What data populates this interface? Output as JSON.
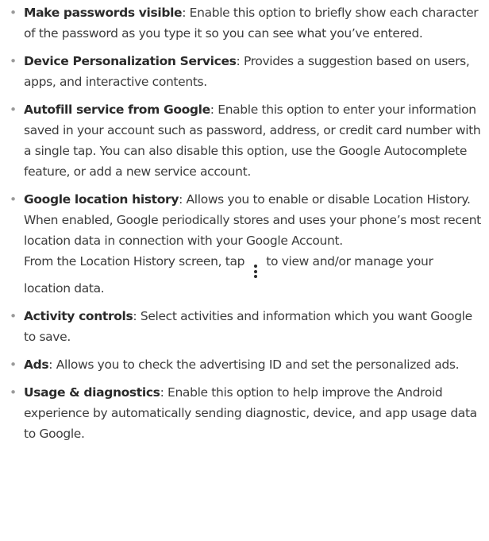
{
  "bullet_char": "•",
  "items": [
    {
      "term": "Make passwords visible",
      "desc": ": Enable this option to briefly show each character of the password as you type it so you can see what you’ve entered."
    },
    {
      "term": "Device Personalization Services",
      "desc": ": Provides a suggestion based on users, apps, and interactive contents."
    },
    {
      "term": "Autofill service from Google",
      "desc": ": Enable this option to enter your information saved in your account such as password, address, or credit card number with a single tap. You can also disable this option, use the Google Autocomplete feature, or add a new service account."
    },
    {
      "term": "Google location history",
      "desc": ": Allows you to enable or disable Location History. When enabled, Google periodically stores and uses your phone’s most recent location data in connection with your Google Account.",
      "extra_before": "From the Location History screen, tap",
      "extra_icon": "more-vert-icon",
      "extra_after": "to view and/or manage your location data."
    },
    {
      "term": "Activity controls",
      "desc": ": Select activities and information which you want Google to save."
    },
    {
      "term": "Ads",
      "desc": ": Allows you to check the advertising ID and set the personalized ads."
    },
    {
      "term": "Usage & diagnostics",
      "desc": ": Enable this option to help improve the Android experience by automatically sending diagnostic, device, and app usage data to Google."
    }
  ]
}
